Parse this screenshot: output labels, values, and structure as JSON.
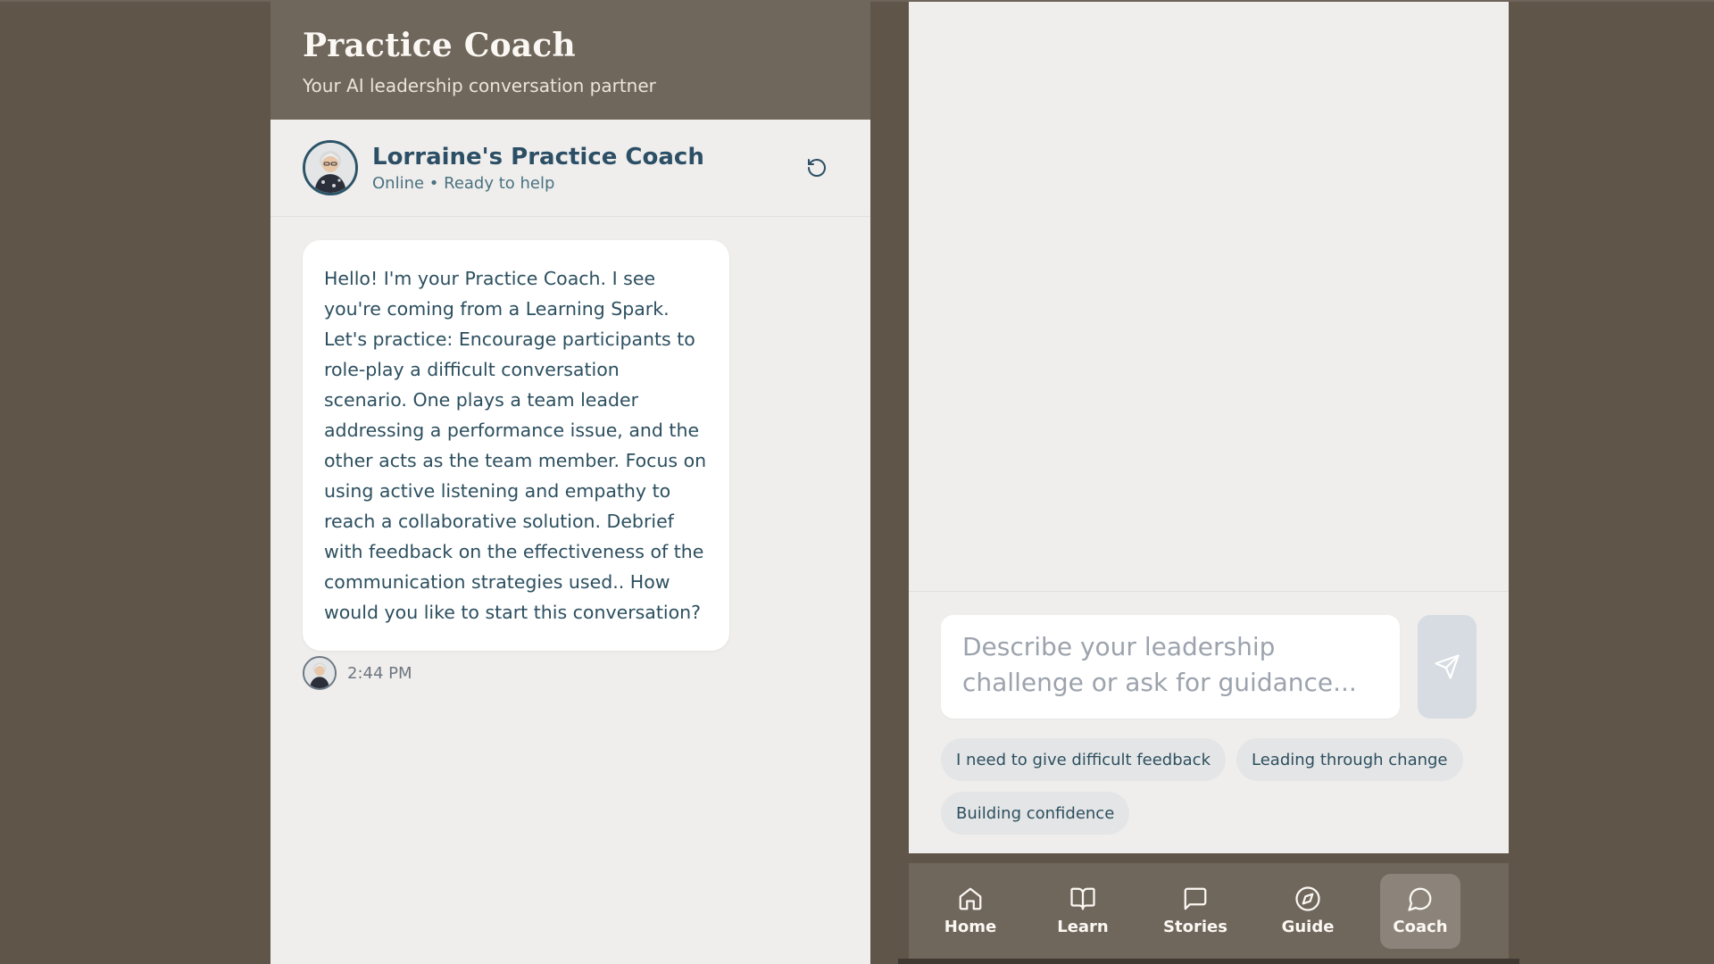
{
  "app": {
    "title": "Practice Coach",
    "subtitle": "Your AI leadership conversation partner"
  },
  "coach": {
    "name": "Lorraine's Practice Coach",
    "status": "Online • Ready to help"
  },
  "messages": [
    {
      "sender": "coach",
      "text": "Hello! I'm your Practice Coach. I see you're coming from a Learning Spark. Let's practice: Encourage participants to role-play a difficult conversation scenario. One plays a team leader addressing a performance issue, and the other acts as the team member. Focus on using active listening and empathy to reach a collaborative solution. Debrief with feedback on the effectiveness of the communication strategies used.. How would you like to start this conversation?",
      "time": "2:44 PM"
    }
  ],
  "composer": {
    "placeholder": "Describe your leadership challenge or ask for guidance...",
    "value": ""
  },
  "suggestions": [
    "I need to give difficult feedback",
    "Leading through change",
    "Building confidence"
  ],
  "nav": {
    "items": [
      {
        "label": "Home",
        "icon": "home-icon"
      },
      {
        "label": "Learn",
        "icon": "book-icon"
      },
      {
        "label": "Stories",
        "icon": "message-square-icon"
      },
      {
        "label": "Guide",
        "icon": "compass-icon"
      },
      {
        "label": "Coach",
        "icon": "message-circle-icon"
      }
    ],
    "active": "Coach"
  },
  "colors": {
    "background": "#5f5549",
    "header": "#6f665c",
    "panel": "#efeeec",
    "accent": "#2c4f66",
    "chip": "#e4e5e6",
    "send_disabled": "#d7dce2"
  }
}
